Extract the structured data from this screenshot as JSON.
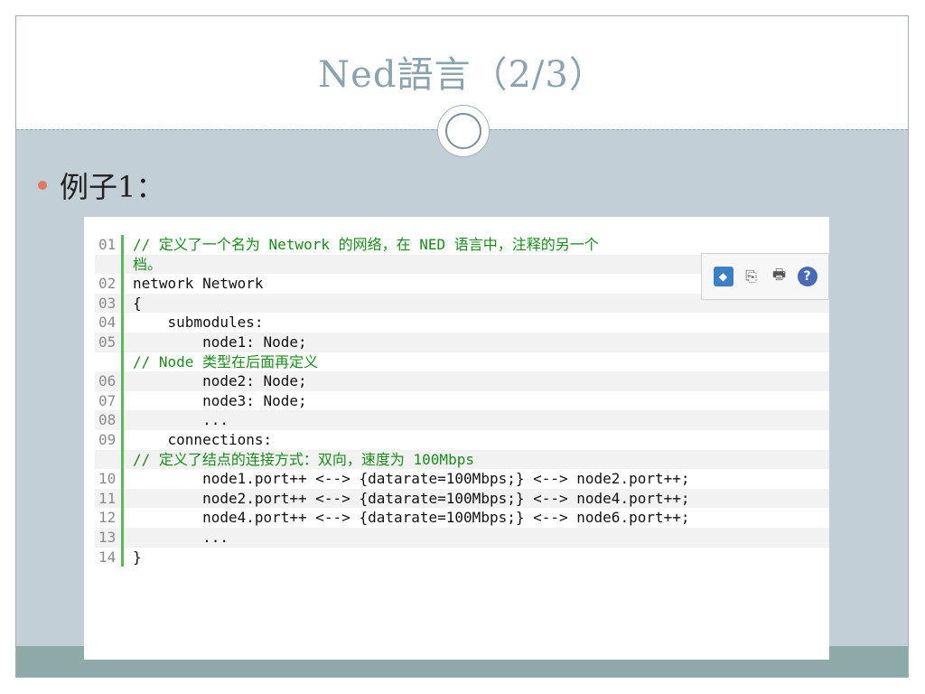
{
  "slide": {
    "title": "Ned語言（2/3）",
    "bullet": "例子1："
  },
  "code_panel": {
    "toolbar": {
      "icons": [
        "view-source-icon",
        "copy-icon",
        "print-icon",
        "help-icon"
      ],
      "glyphs": [
        "◆",
        "⎘",
        "🖶",
        "?"
      ]
    },
    "lines": [
      {
        "num": "01",
        "text": "// 定义了一个名为 Network 的网络，在 NED 语言中，注释的另一个",
        "type": "comment"
      },
      {
        "num": "",
        "text": "档。",
        "type": "comment"
      },
      {
        "num": "02",
        "text": "network Network",
        "type": "code"
      },
      {
        "num": "03",
        "text": "{",
        "type": "code"
      },
      {
        "num": "04",
        "text": "    submodules:",
        "type": "code"
      },
      {
        "num": "05",
        "text": "        node1: Node;",
        "type": "code"
      },
      {
        "num": "",
        "text": "// Node 类型在后面再定义",
        "type": "comment"
      },
      {
        "num": "06",
        "text": "        node2: Node;",
        "type": "code"
      },
      {
        "num": "07",
        "text": "        node3: Node;",
        "type": "code"
      },
      {
        "num": "08",
        "text": "        ...",
        "type": "code"
      },
      {
        "num": "09",
        "text": "    connections:",
        "type": "code"
      },
      {
        "num": "",
        "text": "// 定义了结点的连接方式：双向，速度为 100Mbps",
        "type": "comment"
      },
      {
        "num": "10",
        "text": "        node1.port++ <--> {datarate=100Mbps;} <--> node2.port++;",
        "type": "code"
      },
      {
        "num": "11",
        "text": "        node2.port++ <--> {datarate=100Mbps;} <--> node4.port++;",
        "type": "code"
      },
      {
        "num": "12",
        "text": "        node4.port++ <--> {datarate=100Mbps;} <--> node6.port++;",
        "type": "code"
      },
      {
        "num": "13",
        "text": "        ...",
        "type": "code"
      },
      {
        "num": "14",
        "text": "}",
        "type": "code"
      }
    ]
  },
  "colors": {
    "title": "#8aa3ad",
    "slide_background": "#c3cfd6",
    "bullet": "#e07a5f",
    "comment": "#1c8a1c",
    "gutter_border": "#5cb85c",
    "bottom_band": "#8eaaa8"
  }
}
